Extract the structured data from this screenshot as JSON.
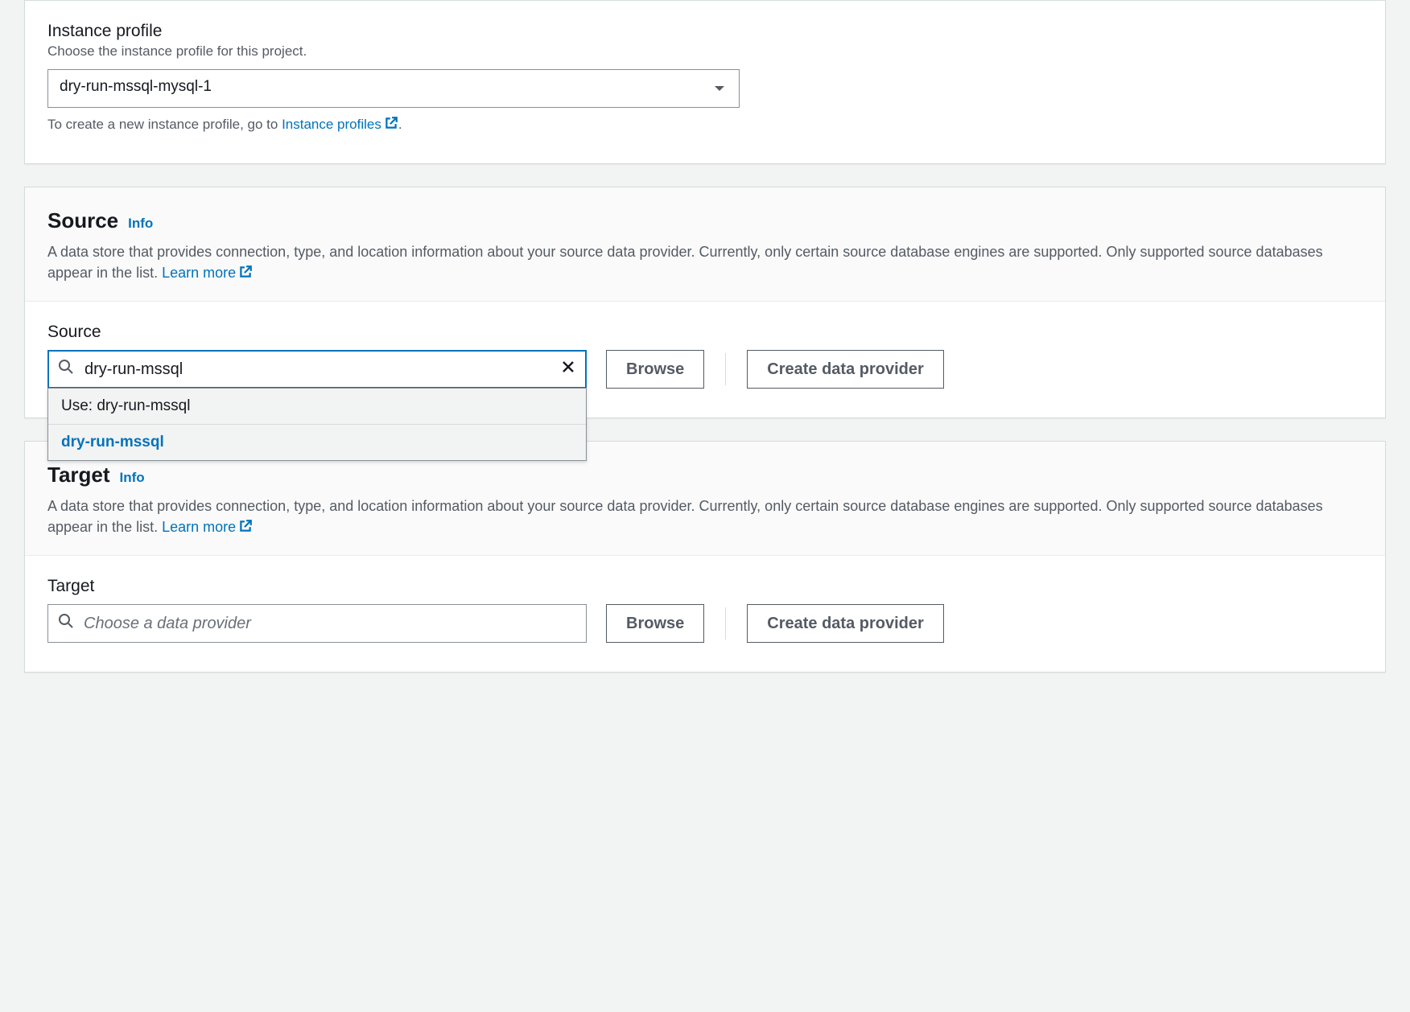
{
  "instance_profile": {
    "label": "Instance profile",
    "hint": "Choose the instance profile for this project.",
    "value": "dry-run-mssql-mysql-1",
    "helper_prefix": "To create a new instance profile, go to ",
    "helper_link": "Instance profiles",
    "helper_suffix": "."
  },
  "source": {
    "title": "Source",
    "info_label": "Info",
    "description_part1": "A data store that provides connection, type, and location information about your source data provider. Currently, only certain source database engines are supported. Only supported source databases appear in the list. ",
    "learn_more": "Learn more",
    "field_label": "Source",
    "search_value": "dry-run-mssql",
    "browse_label": "Browse",
    "create_label": "Create data provider",
    "dropdown": {
      "use_label": "Use: dry-run-mssql",
      "option1": "dry-run-mssql"
    }
  },
  "target": {
    "title": "Target",
    "info_label": "Info",
    "description_part1": "A data store that provides connection, type, and location information about your source data provider. Currently, only certain source database engines are supported. Only supported source databases appear in the list. ",
    "learn_more": "Learn more",
    "field_label": "Target",
    "placeholder": "Choose a data provider",
    "browse_label": "Browse",
    "create_label": "Create data provider"
  }
}
